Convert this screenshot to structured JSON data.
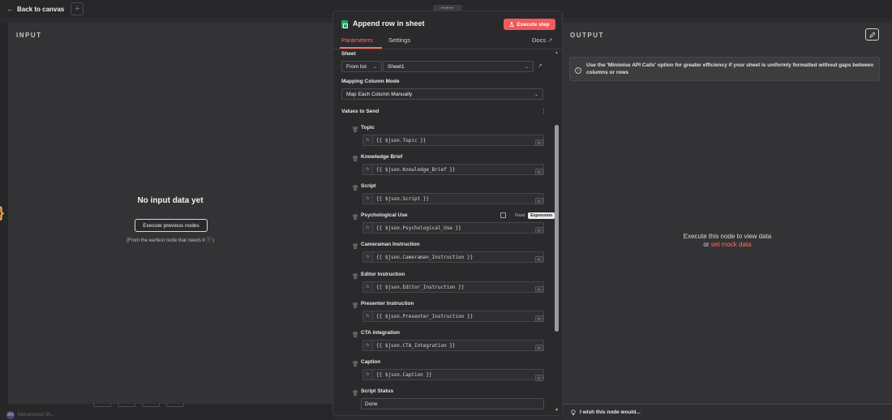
{
  "topbar": {
    "back_label": "Back to canvas",
    "plus": "+",
    "drag_dots": "•••••"
  },
  "input": {
    "heading": "INPUT",
    "empty_title": "No input data yet",
    "execute_previous_label": "Execute previous nodes",
    "hint": "(From the earliest node that needs it ⓘ )"
  },
  "bottom": {
    "user_label": "Mohammed Sh..."
  },
  "node": {
    "title": "Append row in sheet",
    "execute_label": "Execute step",
    "tabs": {
      "parameters": "Parameters",
      "settings": "Settings"
    },
    "docs_label": "Docs",
    "sheet": {
      "label": "Sheet",
      "mode": "From list",
      "value": "Sheet1"
    },
    "mapping": {
      "label": "Mapping Column Mode",
      "value": "Map Each Column Manually"
    },
    "values_label": "Values to Send",
    "toggle": {
      "fixed": "Fixed",
      "expression": "Expression"
    },
    "fields": [
      {
        "label": "Topic",
        "expr": "{{ $json.Topic }}"
      },
      {
        "label": "Knowledge Brief",
        "expr": "{{ $json.Knowledge_Brief }}"
      },
      {
        "label": "Script",
        "expr": "{{ $json.Script }}"
      },
      {
        "label": "Psychological Use",
        "expr": "{{ $json.Psychological_Use }}"
      },
      {
        "label": "Cameraman Instruction",
        "expr": "{{ $json.Cameraman_Instruction }}"
      },
      {
        "label": "Editor Instruction",
        "expr": "{{ $json.Editor_Instruction }}"
      },
      {
        "label": "Presenter Instruction",
        "expr": "{{ $json.Presenter_Instruction }}"
      },
      {
        "label": "CTA integration",
        "expr": "{{ $json.CTA_Integration }}"
      },
      {
        "label": "Caption",
        "expr": "{{ $json.Caption }}"
      }
    ],
    "script_status": {
      "label": "Script Status",
      "value": "Done"
    }
  },
  "output": {
    "heading": "OUTPUT",
    "info": "Use the 'Minimise API Calls' option for greater efficiency if your sheet is uniformly formatted without gaps between columns or rows",
    "execute_hint": "Execute this node to view data",
    "or_label": "or",
    "mock_link": "set mock data",
    "wish_label": "I wish this node would..."
  },
  "colors": {
    "accent": "#ff6d5a",
    "execute_button": "#ef5a5a",
    "sheets_green": "#1fa463",
    "canvas_brace": "#f0a44b"
  }
}
